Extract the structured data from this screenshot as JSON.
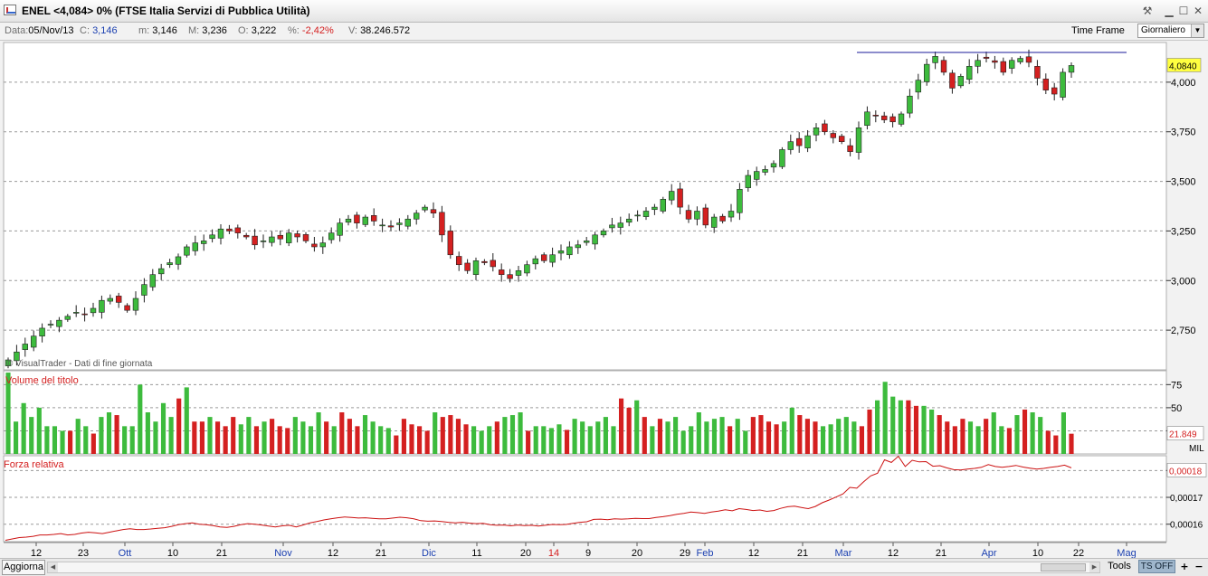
{
  "window": {
    "title": "ENEL <4,084> 0%  (FTSE Italia Servizi di Pubblica Utilità)",
    "icons": [
      "pin-icon",
      "minimize-icon",
      "maximize-icon",
      "close-icon"
    ]
  },
  "infobar": {
    "data_label": "Data:",
    "data_value": "05/Nov/13",
    "c_label": "C:",
    "c_value": "3,146",
    "m_label": "m:",
    "m_value": "3,146",
    "M_label": "M:",
    "M_value": "3,236",
    "O_label": "O:",
    "O_value": "3,222",
    "pct_label": "%:",
    "pct_value": "-2,42%",
    "V_label": "V:",
    "V_value": "38.246.572",
    "timeframe_label": "Time Frame",
    "timeframe_value": "Giornaliero"
  },
  "colors": {
    "up": "#3dbb3d",
    "down": "#d42020",
    "grid": "#9a9a9a",
    "line": "#cc1111",
    "resistance": "#1a1a99",
    "price_badge": "#ffff40"
  },
  "chart_data": [
    {
      "type": "candlestick",
      "price_axis": {
        "ylim": [
          2.55,
          4.2
        ],
        "ticks": [
          "2,750",
          "3,000",
          "3,250",
          "3,500",
          "3,750",
          "4,000"
        ]
      },
      "x_ticks": [
        {
          "label": "12",
          "color": "#000"
        },
        {
          "label": "23",
          "color": "#000"
        },
        {
          "label": "Ott",
          "color": "#1a3fb0"
        },
        {
          "label": "10",
          "color": "#000"
        },
        {
          "label": "21",
          "color": "#000"
        },
        {
          "label": "Nov",
          "color": "#1a3fb0"
        },
        {
          "label": "12",
          "color": "#000"
        },
        {
          "label": "21",
          "color": "#000"
        },
        {
          "label": "Dic",
          "color": "#1a3fb0"
        },
        {
          "label": "11",
          "color": "#000"
        },
        {
          "label": "20",
          "color": "#000"
        },
        {
          "label": "14",
          "color": "#d42020"
        },
        {
          "label": "9",
          "color": "#000"
        },
        {
          "label": "20",
          "color": "#000"
        },
        {
          "label": "29",
          "color": "#000"
        },
        {
          "label": "Feb",
          "color": "#1a3fb0"
        },
        {
          "label": "12",
          "color": "#000"
        },
        {
          "label": "21",
          "color": "#000"
        },
        {
          "label": "Mar",
          "color": "#1a3fb0"
        },
        {
          "label": "12",
          "color": "#000"
        },
        {
          "label": "21",
          "color": "#000"
        },
        {
          "label": "Apr",
          "color": "#1a3fb0"
        },
        {
          "label": "10",
          "color": "#000"
        },
        {
          "label": "22",
          "color": "#000"
        },
        {
          "label": "Mag",
          "color": "#1a3fb0"
        }
      ],
      "last_price": "4,0840",
      "resistance_level": 4.15,
      "watermark": "© VisualTrader - Dati di fine giornata",
      "closes": [
        2.6,
        2.64,
        2.68,
        2.72,
        2.76,
        2.78,
        2.8,
        2.82,
        2.84,
        2.83,
        2.86,
        2.9,
        2.91,
        2.89,
        2.85,
        2.91,
        2.98,
        3.03,
        3.06,
        3.09,
        3.12,
        3.17,
        3.19,
        3.2,
        3.23,
        3.26,
        3.25,
        3.24,
        3.22,
        3.18,
        3.2,
        3.22,
        3.21,
        3.24,
        3.22,
        3.2,
        3.17,
        3.19,
        3.24,
        3.29,
        3.31,
        3.29,
        3.32,
        3.3,
        3.28,
        3.27,
        3.29,
        3.31,
        3.34,
        3.37,
        3.34,
        3.23,
        3.13,
        3.08,
        3.05,
        3.1,
        3.09,
        3.07,
        3.03,
        3.01,
        3.05,
        3.08,
        3.11,
        3.1,
        3.13,
        3.15,
        3.17,
        3.18,
        3.2,
        3.23,
        3.25,
        3.28,
        3.29,
        3.31,
        3.33,
        3.35,
        3.37,
        3.41,
        3.45,
        3.37,
        3.31,
        3.35,
        3.28,
        3.32,
        3.3,
        3.35,
        3.46,
        3.53,
        3.55,
        3.56,
        3.59,
        3.66,
        3.7,
        3.68,
        3.73,
        3.77,
        3.75,
        3.72,
        3.7,
        3.65,
        3.77,
        3.85,
        3.83,
        3.81,
        3.8,
        3.84,
        3.93,
        4.01,
        4.09,
        4.13,
        4.05,
        3.97,
        4.03,
        4.08,
        4.11,
        4.12,
        4.1,
        4.05,
        4.11,
        4.12,
        4.1,
        4.02,
        3.96,
        3.94,
        4.05,
        4.084
      ],
      "ohlc_note": "hand-estimated daily candles"
    },
    {
      "type": "bar",
      "title": "Volume del titolo",
      "unit": "MIL",
      "last_value": "21.849",
      "y_ticks": [
        "25",
        "50",
        "75"
      ],
      "ylim": [
        0,
        90
      ],
      "values": [
        88,
        35,
        55,
        40,
        50,
        30,
        30,
        25,
        25,
        38,
        30,
        22,
        40,
        45,
        42,
        30,
        30,
        75,
        45,
        35,
        55,
        40,
        60,
        72,
        35,
        35,
        40,
        35,
        30,
        40,
        32,
        40,
        30,
        35,
        38,
        30,
        28,
        40,
        35,
        30,
        45,
        35,
        30,
        45,
        38,
        30,
        42,
        35,
        30,
        28,
        20,
        38,
        32,
        30,
        25,
        45,
        40,
        42,
        38,
        32,
        30,
        25,
        30,
        35,
        40,
        42,
        45,
        25,
        30,
        30,
        28,
        32,
        26,
        38,
        35,
        30,
        35,
        40,
        30,
        60,
        50,
        58,
        40,
        30,
        38,
        35,
        40,
        25,
        30,
        45,
        35,
        38,
        40,
        30,
        38,
        25,
        40,
        42,
        35,
        32,
        35,
        50,
        42,
        38,
        35,
        30,
        32,
        38,
        40,
        35,
        30,
        48,
        58,
        78,
        62,
        58,
        58,
        52,
        52,
        48,
        42,
        35,
        30,
        38,
        35,
        30,
        38,
        45,
        30,
        28,
        42,
        48,
        45,
        40,
        25,
        20,
        45,
        21.849
      ],
      "up": [
        1,
        1,
        1,
        1,
        1,
        1,
        1,
        1,
        0,
        1,
        1,
        0,
        1,
        1,
        0,
        1,
        1,
        1,
        1,
        1,
        1,
        1,
        0,
        1,
        0,
        0,
        1,
        0,
        0,
        0,
        1,
        1,
        0,
        1,
        0,
        0,
        0,
        1,
        1,
        1,
        1,
        0,
        1,
        0,
        0,
        0,
        1,
        1,
        1,
        1,
        0,
        0,
        0,
        0,
        0,
        1,
        0,
        0,
        0,
        0,
        1,
        1,
        1,
        0,
        1,
        1,
        1,
        0,
        1,
        1,
        1,
        1,
        0,
        1,
        1,
        1,
        1,
        1,
        1,
        0,
        0,
        1,
        0,
        1,
        0,
        1,
        1,
        1,
        1,
        1,
        1,
        1,
        1,
        0,
        1,
        1,
        0,
        0,
        0,
        0,
        1,
        1,
        0,
        0,
        0,
        1,
        1,
        1,
        1,
        1,
        0,
        0,
        1,
        1,
        1,
        1,
        0,
        0,
        1,
        1,
        0,
        0,
        0,
        0,
        1,
        1,
        0,
        1,
        1,
        0,
        1,
        0,
        1,
        1,
        0,
        0,
        1,
        0
      ]
    },
    {
      "type": "line",
      "title": "Forza relativa",
      "last_value": "0,00018",
      "y_ticks": [
        "0,00016",
        "0,00017",
        "0,00018"
      ],
      "ylim": [
        0.0001535,
        0.0001855
      ],
      "values": [
        0.000154,
        0.0001545,
        0.000155,
        0.0001552,
        0.0001555,
        0.000156,
        0.000156,
        0.0001562,
        0.0001565,
        0.000156,
        0.0001562,
        0.0001567,
        0.000157,
        0.0001568,
        0.0001565,
        0.000157,
        0.0001575,
        0.000158,
        0.0001583,
        0.000158,
        0.000158,
        0.0001582,
        0.0001585,
        0.0001587,
        0.0001592,
        0.0001598,
        0.0001602,
        0.0001605,
        0.00016,
        0.0001598,
        0.0001595,
        0.000159,
        0.0001588,
        0.0001592,
        0.0001598,
        0.0001602,
        0.00016,
        0.0001597,
        0.0001593,
        0.000159,
        0.0001594,
        0.0001596,
        0.000159,
        0.0001597,
        0.0001605,
        0.000161,
        0.0001616,
        0.000162,
        0.0001624,
        0.0001627,
        0.0001625,
        0.0001623,
        0.0001624,
        0.0001622,
        0.000162,
        0.000162,
        0.0001623,
        0.0001626,
        0.0001624,
        0.000162,
        0.0001613,
        0.0001611,
        0.0001612,
        0.000161,
        0.0001607,
        0.0001605,
        0.0001607,
        0.0001604,
        0.0001602,
        0.0001603,
        0.0001598,
        0.0001596,
        0.0001597,
        0.0001594,
        0.0001597,
        0.0001595,
        0.0001596,
        0.0001593,
        0.0001596,
        0.0001599,
        0.0001598,
        0.0001599,
        0.0001603,
        0.0001607,
        0.0001609,
        0.0001618,
        0.0001619,
        0.0001617,
        0.000162,
        0.0001619,
        0.000162,
        0.0001622,
        0.0001621,
        0.0001621,
        0.0001625,
        0.0001628,
        0.0001632,
        0.0001637,
        0.000164,
        0.0001645,
        0.0001643,
        0.000164,
        0.0001645,
        0.0001649,
        0.0001654,
        0.000165,
        0.0001658,
        0.0001655,
        0.0001651,
        0.0001653,
        0.0001648,
        0.0001651,
        0.0001659,
        0.0001665,
        0.0001667,
        0.0001662,
        0.0001658,
        0.0001666,
        0.000168,
        0.000169,
        0.0001701,
        0.0001713,
        0.0001737,
        0.0001734,
        0.0001758,
        0.000178,
        0.000179,
        0.000184,
        0.000183,
        0.0001853,
        0.0001815,
        0.0001838,
        0.0001832,
        0.0001833,
        0.0001816,
        0.0001818,
        0.000181,
        0.0001803,
        0.0001802,
        0.0001805,
        0.0001808,
        0.0001812,
        0.0001822,
        0.0001815,
        0.0001812,
        0.0001815,
        0.0001819,
        0.0001813,
        0.0001809,
        0.0001805,
        0.0001808,
        0.0001812,
        0.0001815,
        0.000182,
        0.000181
      ]
    }
  ],
  "bottombar": {
    "refresh_label": "Aggiorna",
    "tools_label": "Tools",
    "tsoff_label": "TS OFF",
    "zoom_in_label": "+",
    "zoom_out_label": "−"
  }
}
